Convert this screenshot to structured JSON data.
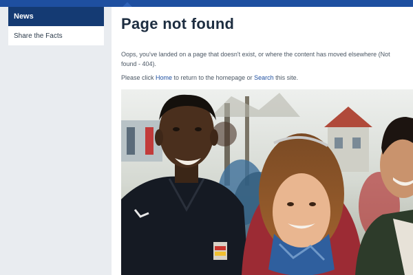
{
  "header": {
    "brand_color": "#1e4fa0"
  },
  "sidebar": {
    "items": [
      {
        "label": "News",
        "active": true
      },
      {
        "label": "Share the Facts",
        "active": false
      }
    ]
  },
  "main": {
    "title": "Page not found",
    "message": "Oops, you've landed on a page that doesn't exist, or where the content has moved elsewhere (Not found - 404).",
    "instruction": {
      "prefix": "Please click ",
      "home_link": "Home",
      "middle": " to return to the homepage or ",
      "search_link": "Search",
      "suffix": " this site."
    },
    "photo": {
      "subject": "group-of-smiling-people"
    }
  }
}
